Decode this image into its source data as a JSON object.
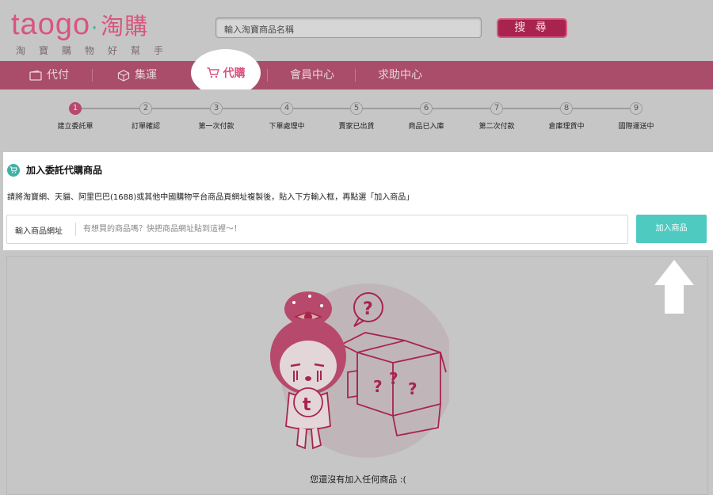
{
  "header": {
    "logo_main": "taogo",
    "logo_dot": "·",
    "logo_cn": "淘購",
    "logo_subtitle": "淘寶購物好幫手",
    "search_placeholder": "輸入淘寶商品名稱",
    "search_button": "搜 尋"
  },
  "nav": {
    "items": [
      {
        "label": "代付",
        "icon": "wallet-icon"
      },
      {
        "label": "集運",
        "icon": "box-icon"
      },
      {
        "label": "代購",
        "icon": "cart-icon",
        "active": true
      },
      {
        "label": "會員中心"
      },
      {
        "label": "求助中心"
      }
    ]
  },
  "steps": [
    {
      "num": "1",
      "label": "建立委託單",
      "active": true
    },
    {
      "num": "2",
      "label": "訂單確認"
    },
    {
      "num": "3",
      "label": "第一次付款"
    },
    {
      "num": "4",
      "label": "下單處理中"
    },
    {
      "num": "5",
      "label": "賣家已出貨"
    },
    {
      "num": "6",
      "label": "商品已入庫"
    },
    {
      "num": "7",
      "label": "第二次付款"
    },
    {
      "num": "8",
      "label": "倉庫理貨中"
    },
    {
      "num": "9",
      "label": "國際運送中"
    }
  ],
  "panel": {
    "title": "加入委託代購商品",
    "description": "請將淘寶網、天貓、阿里巴巴(1688)或其他中國購物平台商品頁網址複製後，貼入下方輸入框，再點選「加入商品」",
    "url_label": "輸入商品網址",
    "url_placeholder": "有想買的商品嗎？快把商品網址貼到這裡～！",
    "url_value": "",
    "add_button": "加入商品"
  },
  "empty": {
    "message": "您還沒有加入任何商品 :(",
    "illustration_marks": "? ? ?",
    "illustration_letter": "t"
  },
  "colors": {
    "brand_pink": "#d9557f",
    "nav_bg": "#a94d6a",
    "teal": "#4ecac1",
    "overlay_gray": "#c6c6c6"
  }
}
